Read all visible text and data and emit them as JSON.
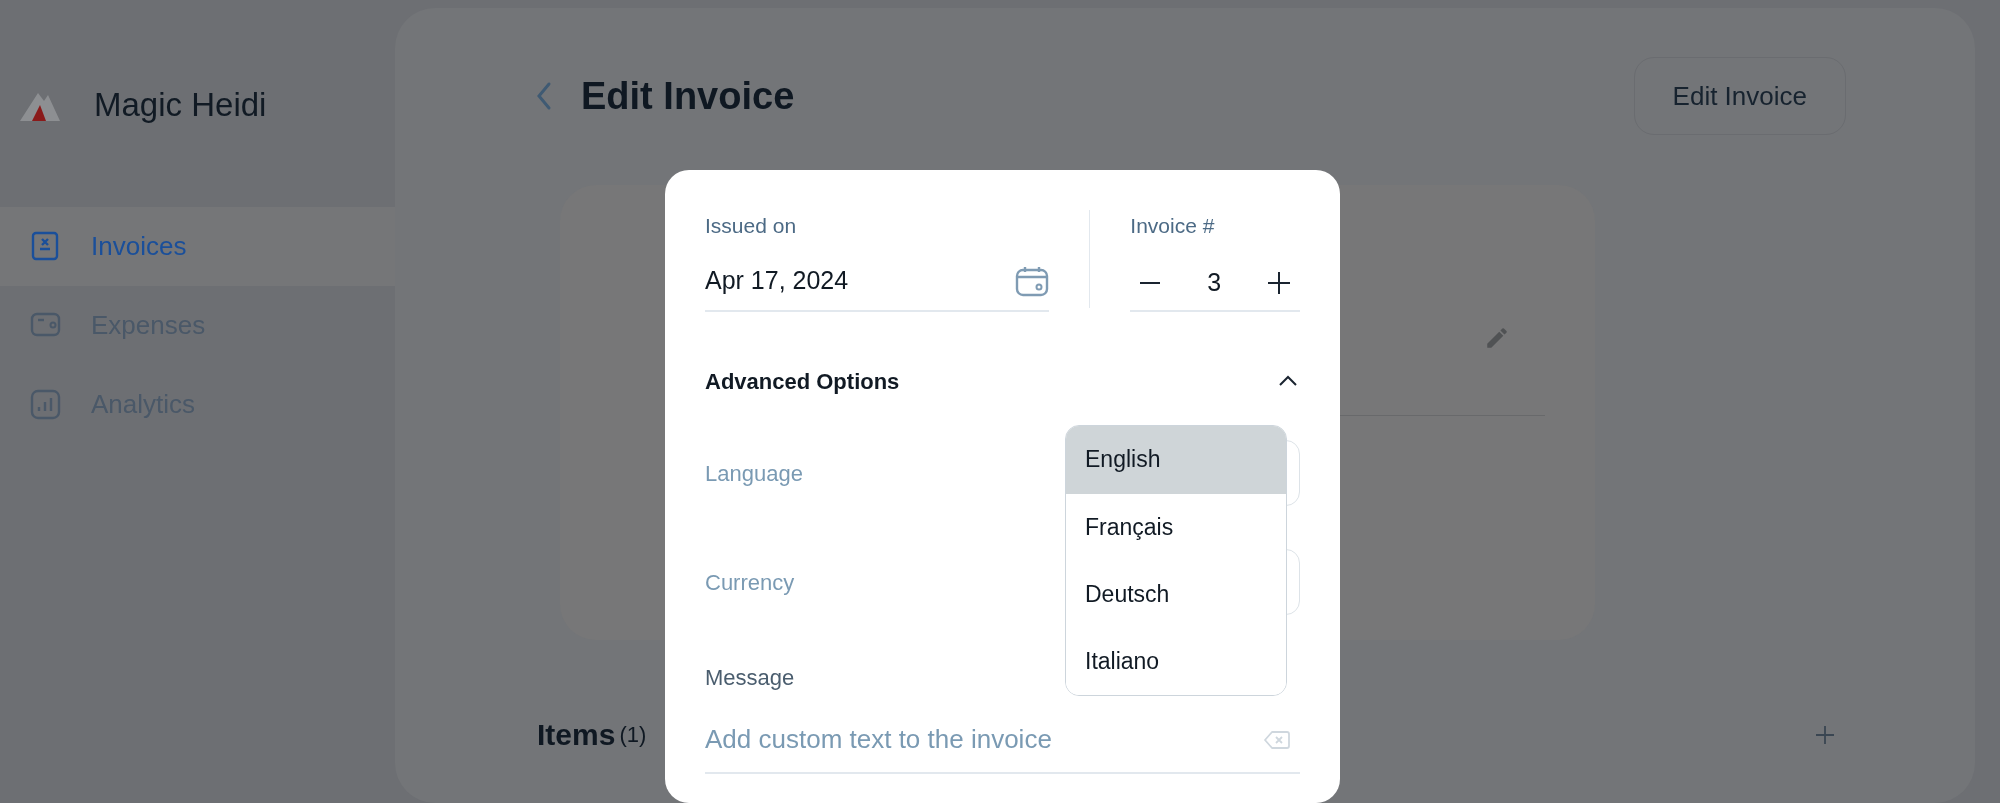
{
  "sidebar": {
    "brand": "Magic Heidi",
    "items": [
      {
        "label": "Invoices",
        "selected": true
      },
      {
        "label": "Expenses",
        "selected": false
      },
      {
        "label": "Analytics",
        "selected": false
      }
    ]
  },
  "header": {
    "title": "Edit Invoice",
    "button": "Edit Invoice"
  },
  "items_section": {
    "title": "Items",
    "count": "(1)"
  },
  "modal": {
    "issued_on": {
      "label": "Issued on",
      "value": "Apr 17, 2024"
    },
    "invoice_number": {
      "label": "Invoice #",
      "value": "3"
    },
    "advanced_options": {
      "title": "Advanced Options",
      "expanded": true
    },
    "fields": [
      {
        "label": "Language"
      },
      {
        "label": "Currency"
      }
    ],
    "language_dropdown": {
      "options": [
        {
          "label": "English",
          "selected": true
        },
        {
          "label": "Français",
          "selected": false
        },
        {
          "label": "Deutsch",
          "selected": false
        },
        {
          "label": "Italiano",
          "selected": false
        }
      ]
    },
    "message": {
      "label": "Message",
      "placeholder": "Add custom text to the invoice"
    }
  }
}
